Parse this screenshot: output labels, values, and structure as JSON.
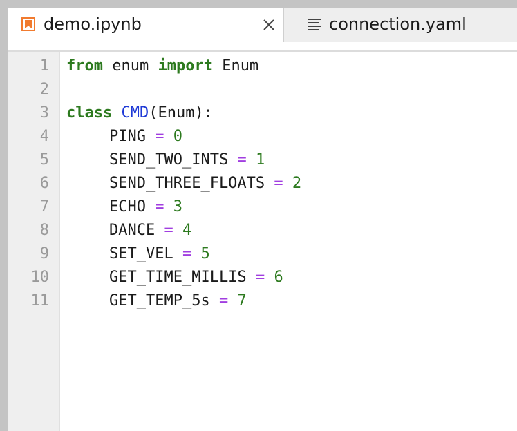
{
  "tabs": [
    {
      "label": "demo.ipynb",
      "icon": "notebook-icon",
      "active": true
    },
    {
      "label": "connection.yaml",
      "icon": "text-file-icon",
      "active": false
    }
  ],
  "colors": {
    "keyword": "#2d7a1f",
    "class_name": "#1f3ad6",
    "operator": "#a13ee0",
    "number": "#2d7a1f",
    "notebook_icon": "#f17b2f"
  },
  "editor": {
    "lines": [
      {
        "n": "1",
        "t": [
          "from",
          " enum ",
          "import",
          " Enum"
        ]
      },
      {
        "n": "2",
        "t": []
      },
      {
        "n": "3",
        "t": [
          "class",
          " ",
          "CMD",
          "(Enum):"
        ]
      },
      {
        "n": "4",
        "t": [
          "PING",
          " ",
          "=",
          " ",
          "0"
        ]
      },
      {
        "n": "5",
        "t": [
          "SEND_TWO_INTS",
          " ",
          "=",
          " ",
          "1"
        ]
      },
      {
        "n": "6",
        "t": [
          "SEND_THREE_FLOATS",
          " ",
          "=",
          " ",
          "2"
        ]
      },
      {
        "n": "7",
        "t": [
          "ECHO",
          " ",
          "=",
          " ",
          "3"
        ]
      },
      {
        "n": "8",
        "t": [
          "DANCE",
          " ",
          "=",
          " ",
          "4"
        ]
      },
      {
        "n": "9",
        "t": [
          "SET_VEL",
          " ",
          "=",
          " ",
          "5"
        ]
      },
      {
        "n": "10",
        "t": [
          "GET_TIME_MILLIS",
          " ",
          "=",
          " ",
          "6"
        ]
      },
      {
        "n": "11",
        "t": [
          "GET_TEMP_5s",
          " ",
          "=",
          " ",
          "7"
        ]
      }
    ]
  }
}
